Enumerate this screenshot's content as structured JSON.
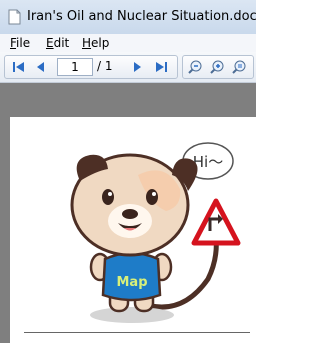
{
  "window": {
    "title": "Iran's Oil and Nuclear Situation.doc"
  },
  "menu": {
    "items": [
      {
        "key": "F",
        "rest": "ile"
      },
      {
        "key": "E",
        "rest": "dit"
      },
      {
        "key": "H",
        "rest": "elp"
      }
    ]
  },
  "toolbar": {
    "page_value": "1",
    "page_total": "/ 1"
  },
  "illustration": {
    "speech_text": "Hi〜",
    "shirt_text": "Map"
  },
  "colors": {
    "titlebar": "#c9d9ec",
    "doc_background": "#7f7f7f",
    "nav_blue": "#2b6cc4"
  }
}
